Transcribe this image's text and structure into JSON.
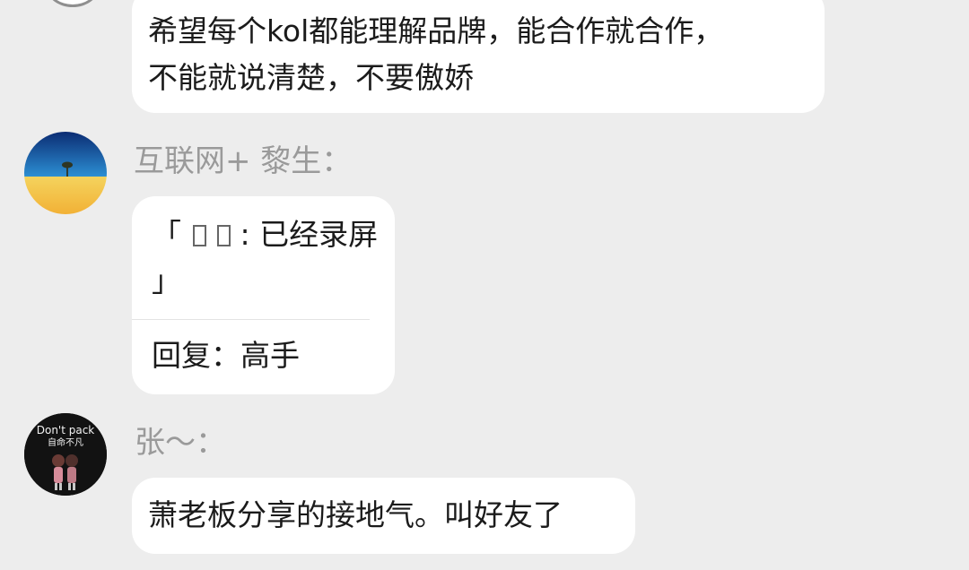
{
  "messages": [
    {
      "text_line1": "希望每个kol都能理解品牌，能合作就合作，",
      "text_line2": "不能就说清楚，不要傲娇"
    },
    {
      "sender": "互联网+ 黎生：",
      "quote_prefix": "「",
      "quote_suffix": ": 已经录屏",
      "quote_close": "」",
      "reply": "回复：高手"
    },
    {
      "sender": "张～：",
      "text": "萧老板分享的接地气。叫好友了",
      "avatar_caption_1": "Don't pack",
      "avatar_caption_2": "自命不凡"
    }
  ]
}
